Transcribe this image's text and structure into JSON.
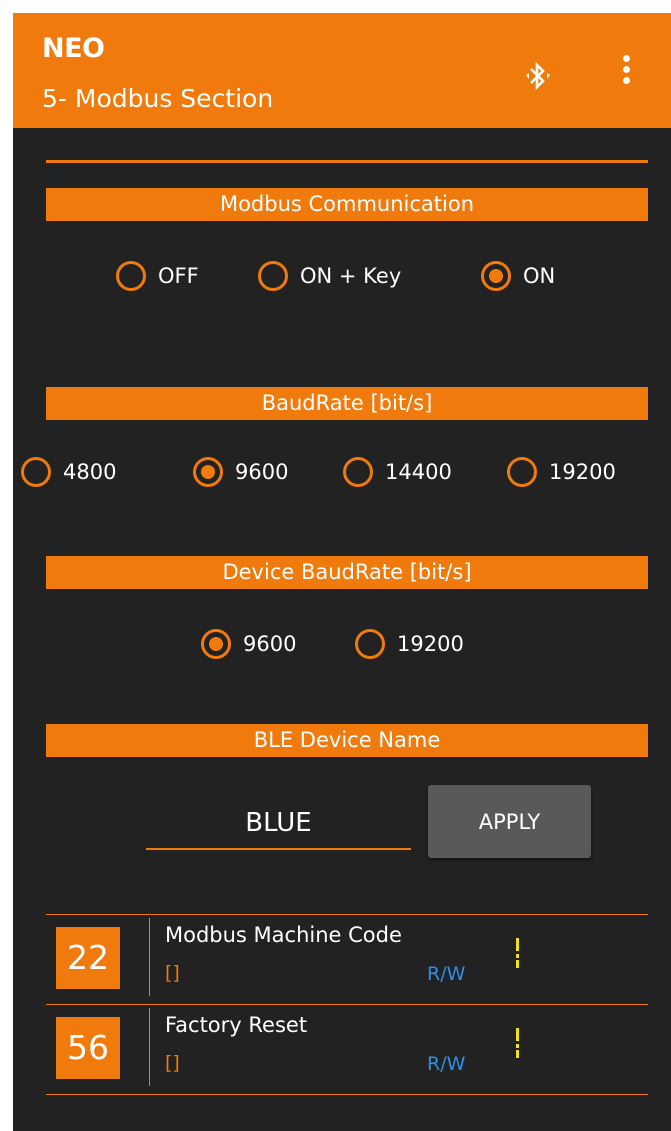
{
  "appbar": {
    "title": "NEO",
    "subtitle": "5- Modbus Section",
    "bluetooth_icon": "bluetooth-searching-icon",
    "menu_icon": "more-vert-icon"
  },
  "sections": {
    "modbus_comm": {
      "header": "Modbus Communication",
      "options": [
        "OFF",
        "ON + Key",
        "ON"
      ],
      "selected": "ON"
    },
    "baudrate": {
      "header": "BaudRate [bit/s]",
      "options": [
        "4800",
        "9600",
        "14400",
        "19200"
      ],
      "selected": "9600"
    },
    "device_baudrate": {
      "header": "Device BaudRate [bit/s]",
      "options": [
        "9600",
        "19200"
      ],
      "selected": "9600"
    },
    "ble_name": {
      "header": "BLE Device Name",
      "value": "BLUE",
      "apply_label": "APPLY"
    }
  },
  "params": [
    {
      "code": "22",
      "title": "Modbus Machine Code",
      "value": "[]",
      "access": "R/W"
    },
    {
      "code": "56",
      "title": "Factory Reset",
      "value": "[]",
      "access": "R/W"
    }
  ],
  "colors": {
    "accent": "#f07a0c",
    "background": "#222222",
    "access_text": "#2f8ee6",
    "indicator": "#f2e21a",
    "button": "#595959"
  }
}
